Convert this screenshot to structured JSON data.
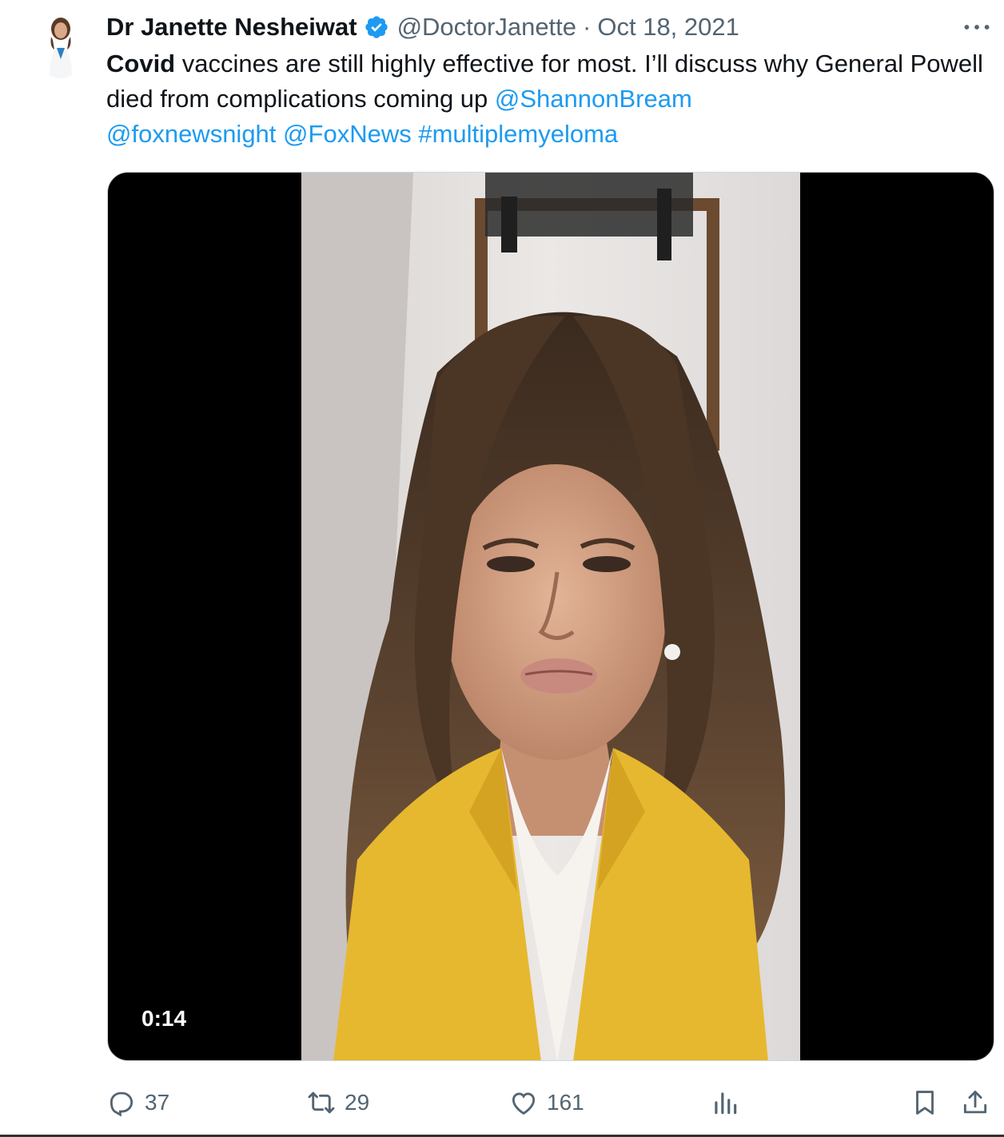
{
  "author": {
    "name": "Dr Janette Nesheiwat",
    "handle": "@DoctorJanette",
    "separator": "·",
    "date": "Oct 18, 2021",
    "verified": true
  },
  "tweet": {
    "bold_word": "Covid",
    "text": " vaccines are still highly effective for most. I’ll discuss why General Powell died from complications coming up ",
    "mentions": [
      "@ShannonBream",
      "@foxnewsnight",
      "@FoxNews"
    ],
    "hashtag": "#multiplemyeloma"
  },
  "media": {
    "type": "video",
    "duration": "0:14"
  },
  "actions": {
    "replies": "37",
    "retweets": "29",
    "likes": "161"
  },
  "icons": {
    "more": "more-icon",
    "reply": "reply-icon",
    "retweet": "retweet-icon",
    "like": "heart-icon",
    "views": "views-icon",
    "bookmark": "bookmark-icon",
    "share": "share-icon",
    "verified": "verified-badge-icon"
  },
  "colors": {
    "link": "#1d9bf0",
    "secondary": "#536471",
    "text": "#0f1419",
    "verified": "#1d9bf0"
  }
}
